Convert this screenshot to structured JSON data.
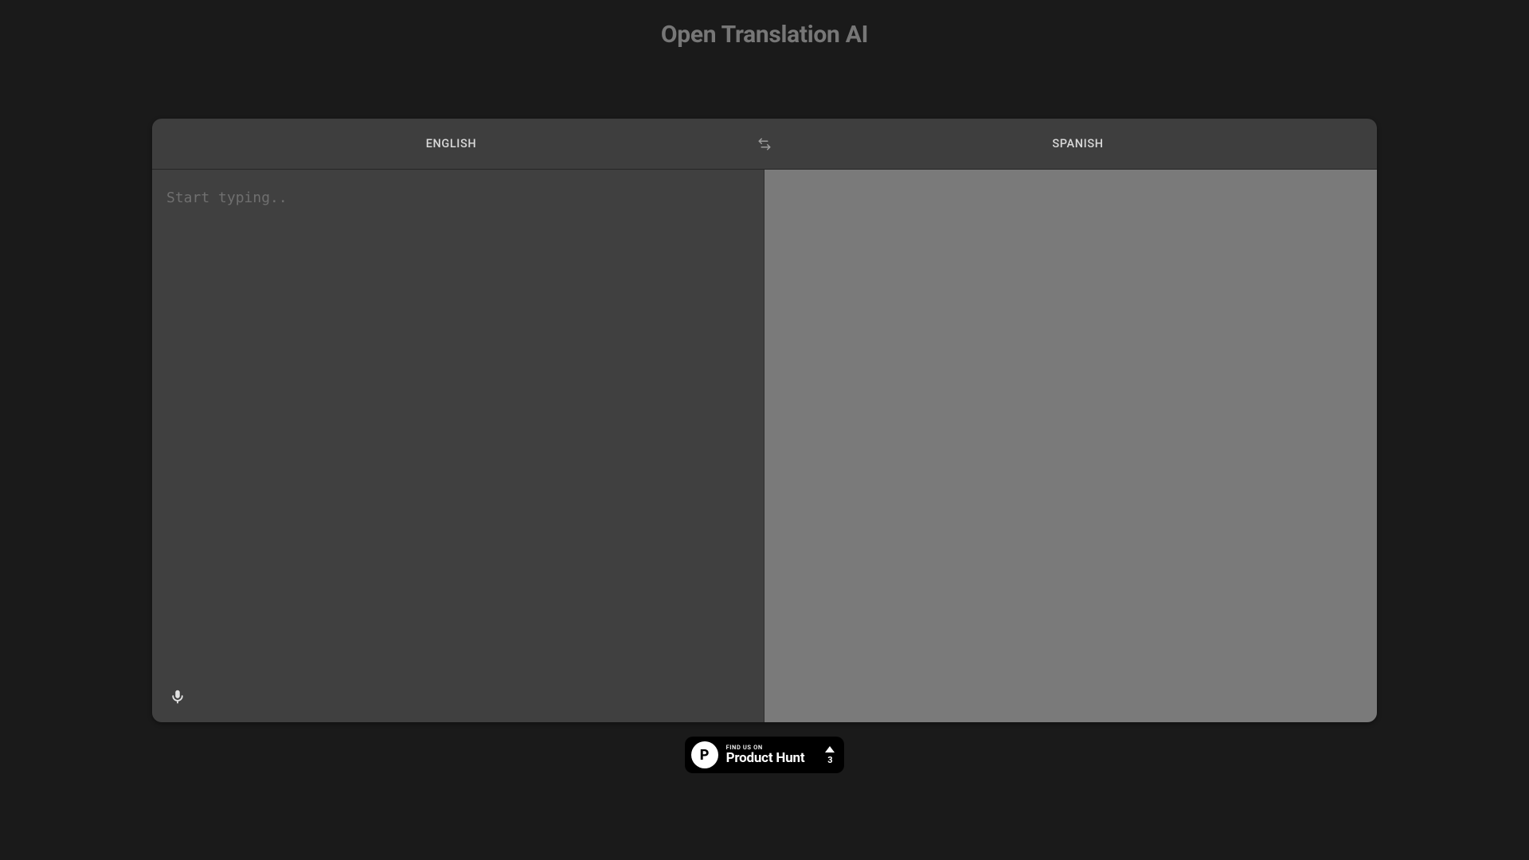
{
  "page_title": "Open Translation AI",
  "translator": {
    "source_language": "ENGLISH",
    "target_language": "SPANISH",
    "source_text": "",
    "source_placeholder": "Start typing..",
    "target_text": ""
  },
  "product_hunt": {
    "tagline_small": "FIND US ON",
    "brand": "Product Hunt",
    "upvotes": "3"
  }
}
